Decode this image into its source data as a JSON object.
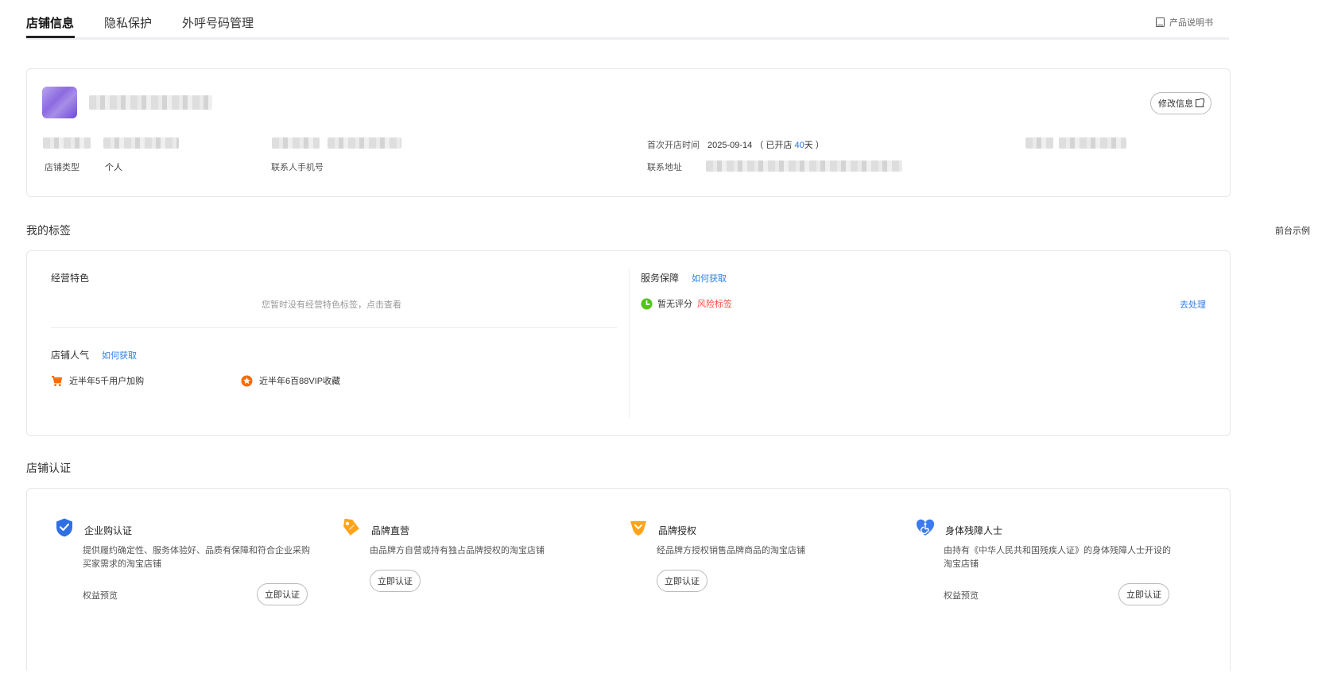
{
  "tabs": [
    {
      "label": "店铺信息"
    },
    {
      "label": "隐私保护"
    },
    {
      "label": "外呼号码管理"
    }
  ],
  "manual_label": "产品说明书",
  "store": {
    "edit_label": "修改信息",
    "store_type_label": "店铺类型",
    "store_type_value": "个人",
    "phone_label": "联系人手机号",
    "open_time_label": "首次开店时间",
    "open_date": "2025-09-14",
    "open_prefix": "（ 已开店 ",
    "open_days": "40",
    "open_suffix": "天 ）",
    "address_label": "联系地址"
  },
  "tags_section": {
    "title": "我的标签",
    "example_link": "前台示例",
    "business_features": {
      "title": "经营特色",
      "empty_hint": "您暂时没有经营特色标签，点击查看"
    },
    "popularity": {
      "title": "店铺人气",
      "how_link": "如何获取",
      "items": [
        {
          "icon": "cart-icon",
          "text": "近半年5千用户加购"
        },
        {
          "icon": "star-icon",
          "text": "近半年6百88VIP收藏"
        }
      ]
    },
    "service": {
      "title": "服务保障",
      "how_link": "如何获取",
      "status": "暂无评分",
      "risk_link": "风险标签",
      "action": "去处理"
    }
  },
  "cert_section": {
    "title": "店铺认证",
    "items": [
      {
        "icon": "shield-check-icon",
        "name": "企业购认证",
        "desc": "提供履约确定性、服务体验好、品质有保障和符合企业采购买家需求的淘宝店铺",
        "perk": "权益预览",
        "button": "立即认证"
      },
      {
        "icon": "brand-tag-icon",
        "name": "品牌直营",
        "desc": "由品牌方自营或持有独占品牌授权的淘宝店铺",
        "perk": "",
        "button": "立即认证"
      },
      {
        "icon": "brand-authorized-icon",
        "name": "品牌授权",
        "desc": "经品牌方授权销售品牌商品的淘宝店铺",
        "perk": "",
        "button": "立即认证"
      },
      {
        "icon": "accessibility-heart-icon",
        "name": "身体残障人士",
        "desc": "由持有《中华人民共和国残疾人证》的身体残障人士开设的淘宝店铺",
        "perk": "权益预览",
        "button": "立即认证"
      }
    ]
  },
  "colors": {
    "link_blue": "#2f7ee8",
    "risk_red": "#f24c3d",
    "status_green": "#52c41a",
    "orange": "#ff6a00"
  }
}
